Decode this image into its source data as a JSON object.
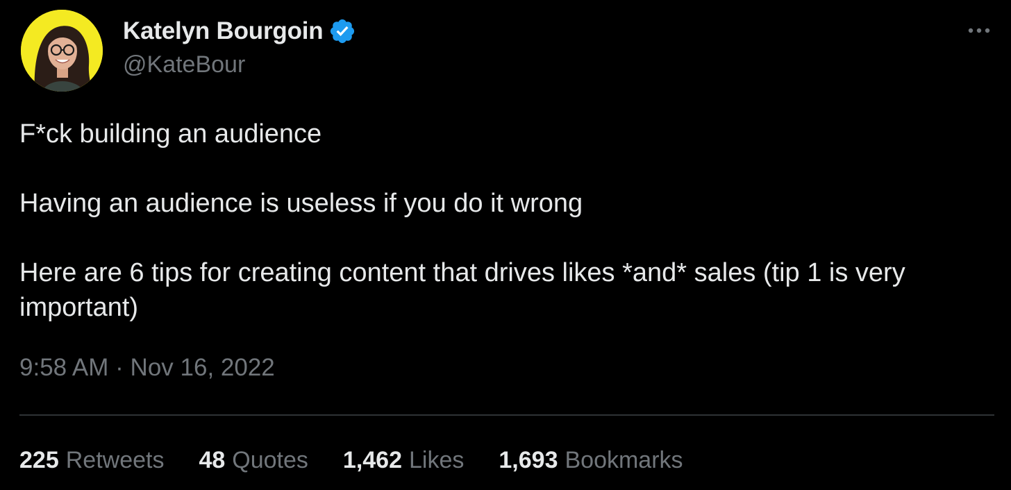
{
  "author": {
    "display_name": "Katelyn Bourgoin",
    "handle": "@KateBour",
    "verified": true,
    "avatar_bg": "#f4ea22"
  },
  "more_icon": "more-horizontal-icon",
  "tweet": {
    "paragraphs": [
      "F*ck building an audience",
      "Having an audience is useless if you do it wrong",
      "Here are 6 tips for creating content that drives likes *and* sales (tip 1 is very important)"
    ],
    "time": "9:58 AM",
    "separator": "·",
    "date": "Nov 16, 2022"
  },
  "stats": [
    {
      "count": "225",
      "label": "Retweets"
    },
    {
      "count": "48",
      "label": "Quotes"
    },
    {
      "count": "1,462",
      "label": "Likes"
    },
    {
      "count": "1,693",
      "label": "Bookmarks"
    }
  ],
  "colors": {
    "background": "#000000",
    "primary_text": "#e7e9ea",
    "secondary_text": "#71767b",
    "verified_blue": "#1d9bf0",
    "divider": "#2f3336"
  }
}
